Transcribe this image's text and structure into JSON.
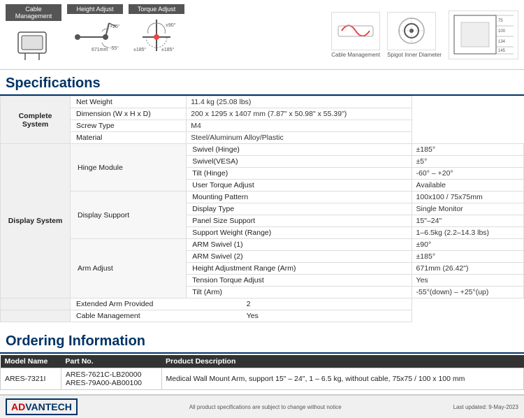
{
  "topFeatures": [
    {
      "label": "Cable\nManagement",
      "annotations": []
    },
    {
      "label": "Height Adjust",
      "value": "671mm",
      "annotations": [
        "+25°",
        "-55°"
      ]
    },
    {
      "label": "Torque Adjust",
      "annotations": [
        "±90°",
        "±185°",
        "±185°"
      ]
    }
  ],
  "topDiagrams": [
    {
      "label": "Cable Management"
    },
    {
      "label": "Spigot Inner Diameter"
    },
    {
      "label": ""
    }
  ],
  "sections": {
    "specifications": {
      "title": "Specifications",
      "groups": [
        {
          "group": "Complete System",
          "rows": [
            {
              "param": "Net Weight",
              "value": "11.4 kg (25.08 lbs)"
            },
            {
              "param": "Dimension (W x H x D)",
              "value": "200 x 1295 x 1407 mm (7.87\" x 50.98\" x 55.39\")"
            },
            {
              "param": "Screw Type",
              "value": "M4"
            },
            {
              "param": "Material",
              "value": "Steel/Aluminum Alloy/Plastic"
            }
          ]
        },
        {
          "group": "Display System",
          "subGroups": [
            {
              "subGroup": "Hinge Module",
              "rows": [
                {
                  "param": "Swivel (Hinge)",
                  "value": "±185°"
                },
                {
                  "param": "Swivel(VESA)",
                  "value": "±5°"
                },
                {
                  "param": "Tilt (Hinge)",
                  "value": "-60° – +20°"
                },
                {
                  "param": "User Torque Adjust",
                  "value": "Available"
                }
              ]
            },
            {
              "subGroup": "Display Support",
              "rows": [
                {
                  "param": "Mounting Pattern",
                  "value": "100x100 / 75x75mm"
                },
                {
                  "param": "Display Type",
                  "value": "Single Monitor"
                },
                {
                  "param": "Panel Size Support",
                  "value": "15\"–24\""
                },
                {
                  "param": "Support Weight (Range)",
                  "value": "1–6.5kg (2.2–14.3 lbs)"
                }
              ]
            },
            {
              "subGroup": "Arm Adjust",
              "rows": [
                {
                  "param": "ARM Swivel (1)",
                  "value": "±90°"
                },
                {
                  "param": "ARM Swivel (2)",
                  "value": "±185°"
                },
                {
                  "param": "Height Adjustment Range (Arm)",
                  "value": "671mm (26.42\")"
                },
                {
                  "param": "Tension Torque Adjust",
                  "value": "Yes"
                },
                {
                  "param": "Tilt (Arm)",
                  "value": "-55°(down) – +25°(up)"
                }
              ]
            }
          ],
          "bottomRows": [
            {
              "param": "Extended Arm Provided",
              "value": "2"
            },
            {
              "param": "Cable Management",
              "value": "Yes"
            }
          ]
        }
      ]
    },
    "ordering": {
      "title": "Ordering Information",
      "headers": [
        "Model Name",
        "Part No.",
        "Product Description"
      ],
      "rows": [
        {
          "model": "ARES-7321I",
          "parts": [
            "ARES-7621C-LB20000",
            "ARES-79A00-AB00100"
          ],
          "description": "Medical Wall Mount Arm, support 15\" – 24\", 1 – 6.5 kg, without cable, 75x75 / 100 x 100 mm"
        }
      ]
    }
  },
  "footer": {
    "logo": "ADVANTECH",
    "note": "All product specifications are subject to change without notice",
    "date": "Last updated: 9-May-2023"
  }
}
